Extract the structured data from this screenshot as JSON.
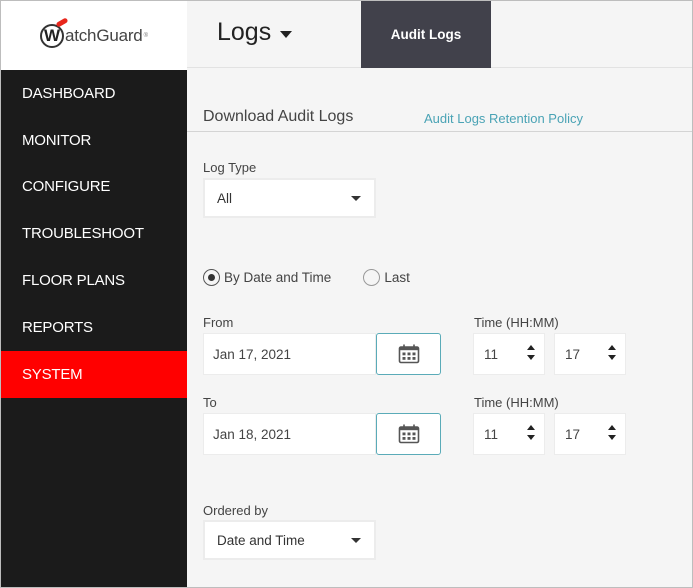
{
  "brand": {
    "logo_letter": "W",
    "logo_text": "atchGuard",
    "logo_tm": "®",
    "accent_color": "#ff0000"
  },
  "sidebar": {
    "items": [
      {
        "label": "DASHBOARD",
        "active": false
      },
      {
        "label": "MONITOR",
        "active": false
      },
      {
        "label": "CONFIGURE",
        "active": false
      },
      {
        "label": "TROUBLESHOOT",
        "active": false
      },
      {
        "label": "FLOOR PLANS",
        "active": false
      },
      {
        "label": "REPORTS",
        "active": false
      },
      {
        "label": "SYSTEM",
        "active": true
      }
    ]
  },
  "header": {
    "title": "Logs",
    "title_icon": "caret-down-icon",
    "tabs": [
      {
        "label": "Audit Logs",
        "active": true
      }
    ]
  },
  "section": {
    "title": "Download Audit Logs",
    "policy_link": "Audit Logs Retention Policy"
  },
  "form": {
    "log_type": {
      "label": "Log Type",
      "value": "All"
    },
    "mode": {
      "options": [
        {
          "label": "By Date and Time",
          "checked": true
        },
        {
          "label": "Last",
          "checked": false
        }
      ]
    },
    "from": {
      "label": "From",
      "date": "Jan 17, 2021",
      "time_label": "Time (HH:MM)",
      "hour": "11",
      "minute": "17"
    },
    "to": {
      "label": "To",
      "date": "Jan 18, 2021",
      "time_label": "Time (HH:MM)",
      "hour": "11",
      "minute": "17"
    },
    "ordered_by": {
      "label": "Ordered by",
      "value": "Date and Time"
    }
  }
}
